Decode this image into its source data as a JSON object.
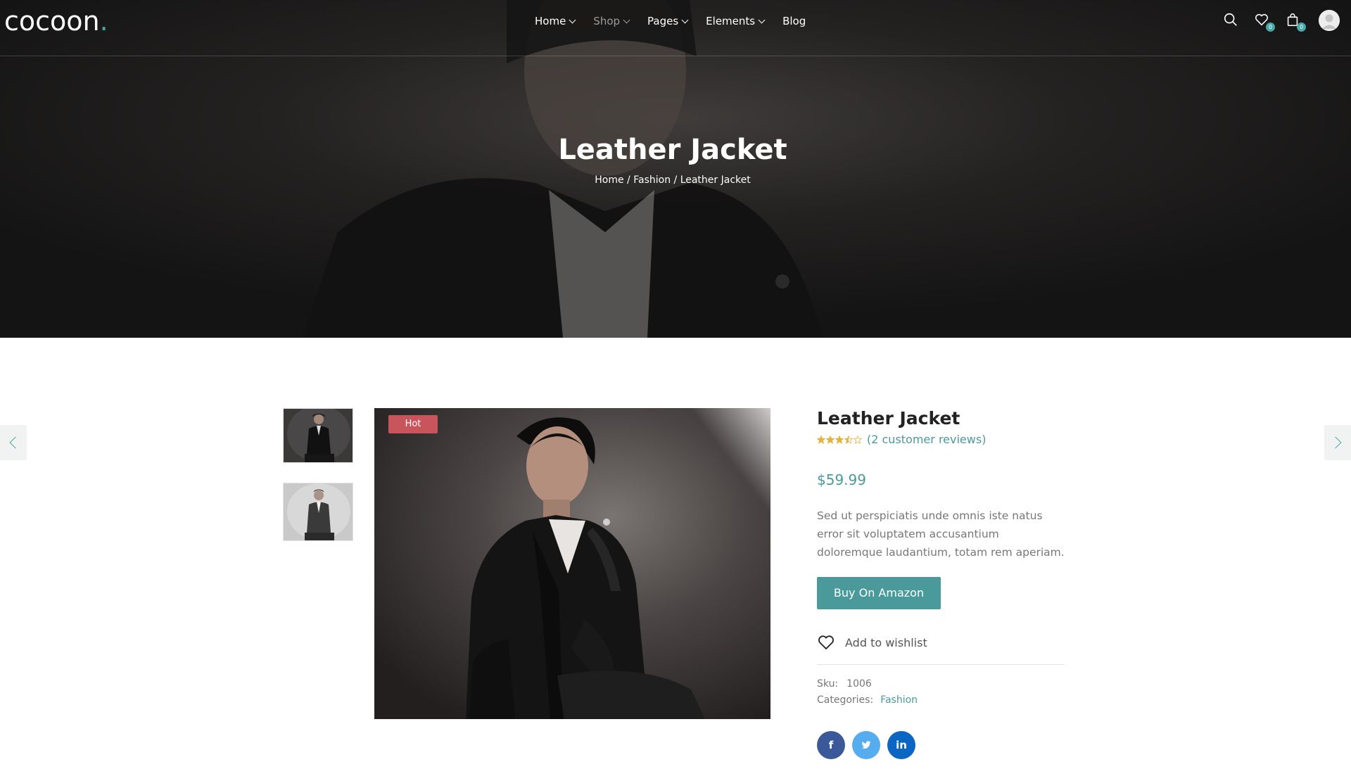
{
  "brand": {
    "name": "cocoon",
    "dot": ".",
    "accent_color": "#4aa7a8"
  },
  "nav": {
    "items": [
      {
        "label": "Home",
        "has_dropdown": true,
        "active": false
      },
      {
        "label": "Shop",
        "has_dropdown": true,
        "active": true
      },
      {
        "label": "Pages",
        "has_dropdown": true,
        "active": false
      },
      {
        "label": "Elements",
        "has_dropdown": true,
        "active": false
      },
      {
        "label": "Blog",
        "has_dropdown": false,
        "active": false
      }
    ]
  },
  "header_icons": {
    "search": "search-icon",
    "wishlist": {
      "icon": "heart-icon",
      "count": "0"
    },
    "cart": {
      "icon": "shopping-bag-icon",
      "count": "0"
    },
    "account": "user-avatar-icon"
  },
  "hero": {
    "title": "Leather Jacket",
    "breadcrumb": {
      "home": "Home",
      "separator": " / ",
      "category": "Fashion",
      "current": "Leather Jacket"
    }
  },
  "gallery": {
    "badge": "Hot",
    "badge_color": "#c9555c",
    "thumbnails": [
      "leather-jacket-thumb-dark",
      "leather-jacket-thumb-light"
    ],
    "main_image": "man-in-leather-jacket-photo"
  },
  "product": {
    "title": "Leather Jacket",
    "rating": 3.5,
    "rating_max": 5,
    "reviews_link": "(2 customer reviews)",
    "price": "$59.99",
    "description": "Sed ut perspiciatis unde omnis iste natus error sit voluptatem accusantium doloremque laudantium, totam rem aperiam.",
    "buy_button": "Buy On Amazon",
    "wishlist_label": "Add to wishlist",
    "sku_label": "Sku:",
    "sku_value": "1006",
    "categories_label": "Categories:",
    "category_value": "Fashion",
    "social": [
      {
        "name": "facebook-icon",
        "glyph": "f"
      },
      {
        "name": "twitter-icon",
        "glyph": "t"
      },
      {
        "name": "linkedin-icon",
        "glyph": "in"
      }
    ]
  },
  "theme": {
    "accent": "#4a9a9c",
    "hot": "#c9555c",
    "star": "#e8b33a"
  }
}
